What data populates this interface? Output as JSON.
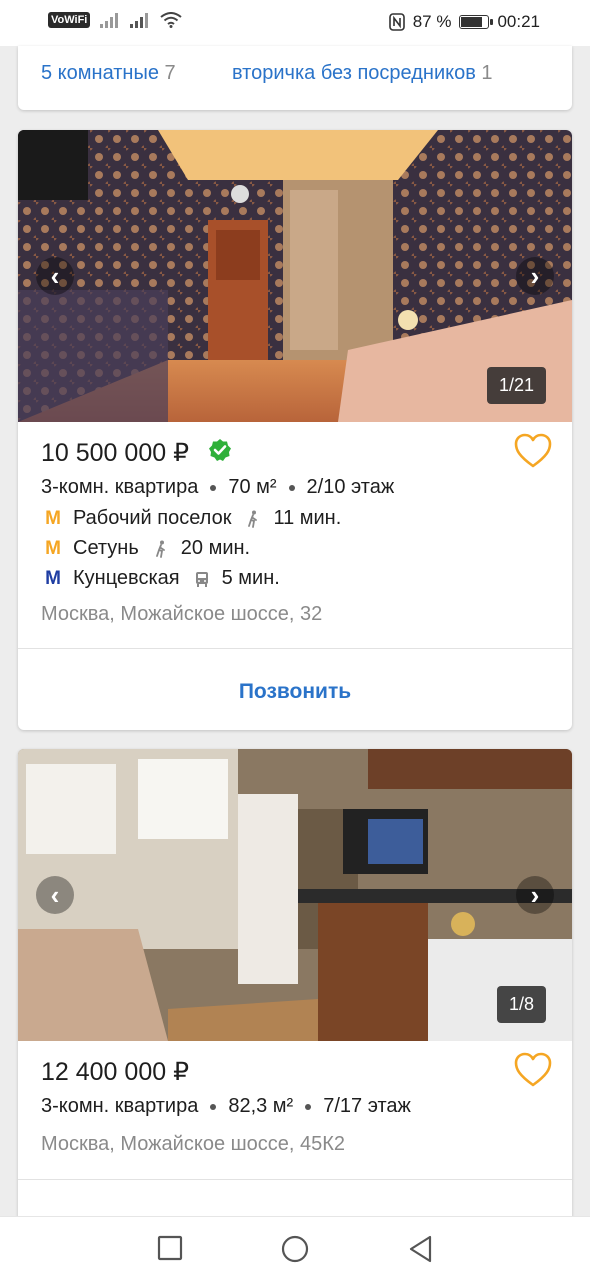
{
  "status_bar": {
    "vowifi": "VoWiFi",
    "battery_pct": "87 %",
    "battery_level": 0.87,
    "time": "00:21"
  },
  "tags": [
    {
      "label": "5 комнатные",
      "count": "7"
    },
    {
      "label": "вторичка без посредников",
      "count": "1"
    }
  ],
  "listings": [
    {
      "photo_counter": "1/21",
      "price": "10 500 000 ₽",
      "verified": true,
      "type": "3-комн. квартира",
      "area": "70 м²",
      "floor": "2/10 этаж",
      "metro": [
        {
          "logo": "M",
          "color": "#f5a623",
          "station": "Рабочий поселок",
          "transport": "walk",
          "time": "11 мин."
        },
        {
          "logo": "M",
          "color": "#f5a623",
          "station": "Сетунь",
          "transport": "walk",
          "time": "20 мин."
        },
        {
          "logo": "M",
          "color": "#1f3ea3",
          "station": "Кунцевская",
          "transport": "bus",
          "time": "5 мин."
        }
      ],
      "address": "Москва, Можайское шоссе, 32",
      "call_label": "Позвонить"
    },
    {
      "photo_counter": "1/8",
      "price": "12 400 000 ₽",
      "verified": false,
      "type": "3-комн. квартира",
      "area": "82,3 м²",
      "floor": "7/17 этаж",
      "address": "Москва, Можайское шоссе, 45К2"
    }
  ],
  "icons": {
    "prev": "chevron-left-icon",
    "next": "chevron-right-icon",
    "favorite": "heart-icon",
    "verified": "verified-check-icon"
  },
  "colors": {
    "accent": "#2a73c9",
    "heart": "#f5a623",
    "verified": "#2fb03a"
  }
}
